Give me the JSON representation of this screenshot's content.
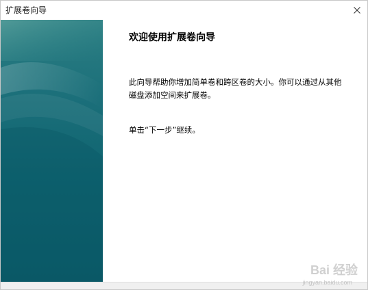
{
  "window": {
    "title": "扩展卷向导",
    "close_icon": "close-icon"
  },
  "content": {
    "heading": "欢迎使用扩展卷向导",
    "description_line1": "此向导帮助你增加简单卷和跨区卷的大小。你可以通过从其他",
    "description_line2": "磁盘添加空间来扩展卷。",
    "instruction": "单击“下一步”继续。"
  },
  "watermark": {
    "text": "Bai 经验",
    "sub": "jingyan.baidu.com"
  },
  "colors": {
    "side_panel_top": "#2c7f83",
    "side_panel_bottom": "#0b5a68",
    "footer": "#f0f0f0"
  }
}
